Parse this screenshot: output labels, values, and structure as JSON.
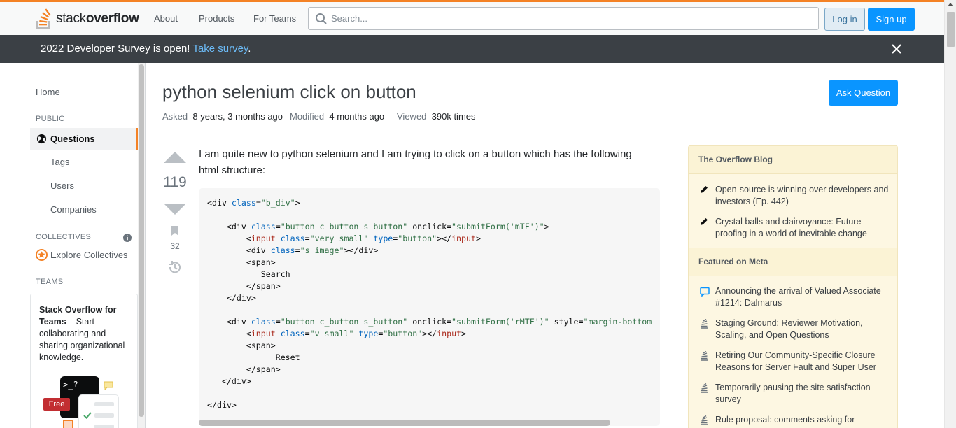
{
  "header": {
    "logo_prefix": "stack",
    "logo_bold": "overflow",
    "nav": [
      "About",
      "Products",
      "For Teams"
    ],
    "search_placeholder": "Search...",
    "login_label": "Log in",
    "signup_label": "Sign up",
    "accent_color": "#f48225"
  },
  "banner": {
    "text": "2022 Developer Survey is open! ",
    "link": "Take survey",
    "suffix": "."
  },
  "sidebar": {
    "home": "Home",
    "public_heading": "PUBLIC",
    "questions": "Questions",
    "tags": "Tags",
    "users": "Users",
    "companies": "Companies",
    "collectives_heading": "COLLECTIVES",
    "explore_collectives": "Explore Collectives",
    "teams_heading": "TEAMS",
    "teams_title": "Stack Overflow for Teams",
    "teams_body": " – Start collaborating and sharing organizational knowledge.",
    "free_badge": "Free",
    "terminal_glyph": ">_?"
  },
  "question": {
    "title": "python selenium click on button",
    "ask_button": "Ask Question",
    "asked_label": "Asked",
    "asked_value": "8 years, 3 months ago",
    "modified_label": "Modified",
    "modified_value": "4 months ago",
    "viewed_label": "Viewed",
    "viewed_value": "390k times",
    "votes": "119",
    "bookmarks": "32",
    "body_text": "I am quite new to python selenium and I am trying to click on a button which has the following html structure:"
  },
  "blog": {
    "heading": "The Overflow Blog",
    "items": [
      "Open-source is winning over developers and investors (Ep. 442)",
      "Crystal balls and clairvoyance: Future proofing in a world of inevitable change"
    ]
  },
  "meta": {
    "heading": "Featured on Meta",
    "items": [
      "Announcing the arrival of Valued Associate #1214: Dalmarus",
      "Staging Ground: Reviewer Motivation, Scaling, and Open Questions",
      "Retiring Our Community-Specific Closure Reasons for Server Fault and Super User",
      "Temporarily pausing the site satisfaction survey",
      "Rule proposal: comments asking for"
    ]
  }
}
